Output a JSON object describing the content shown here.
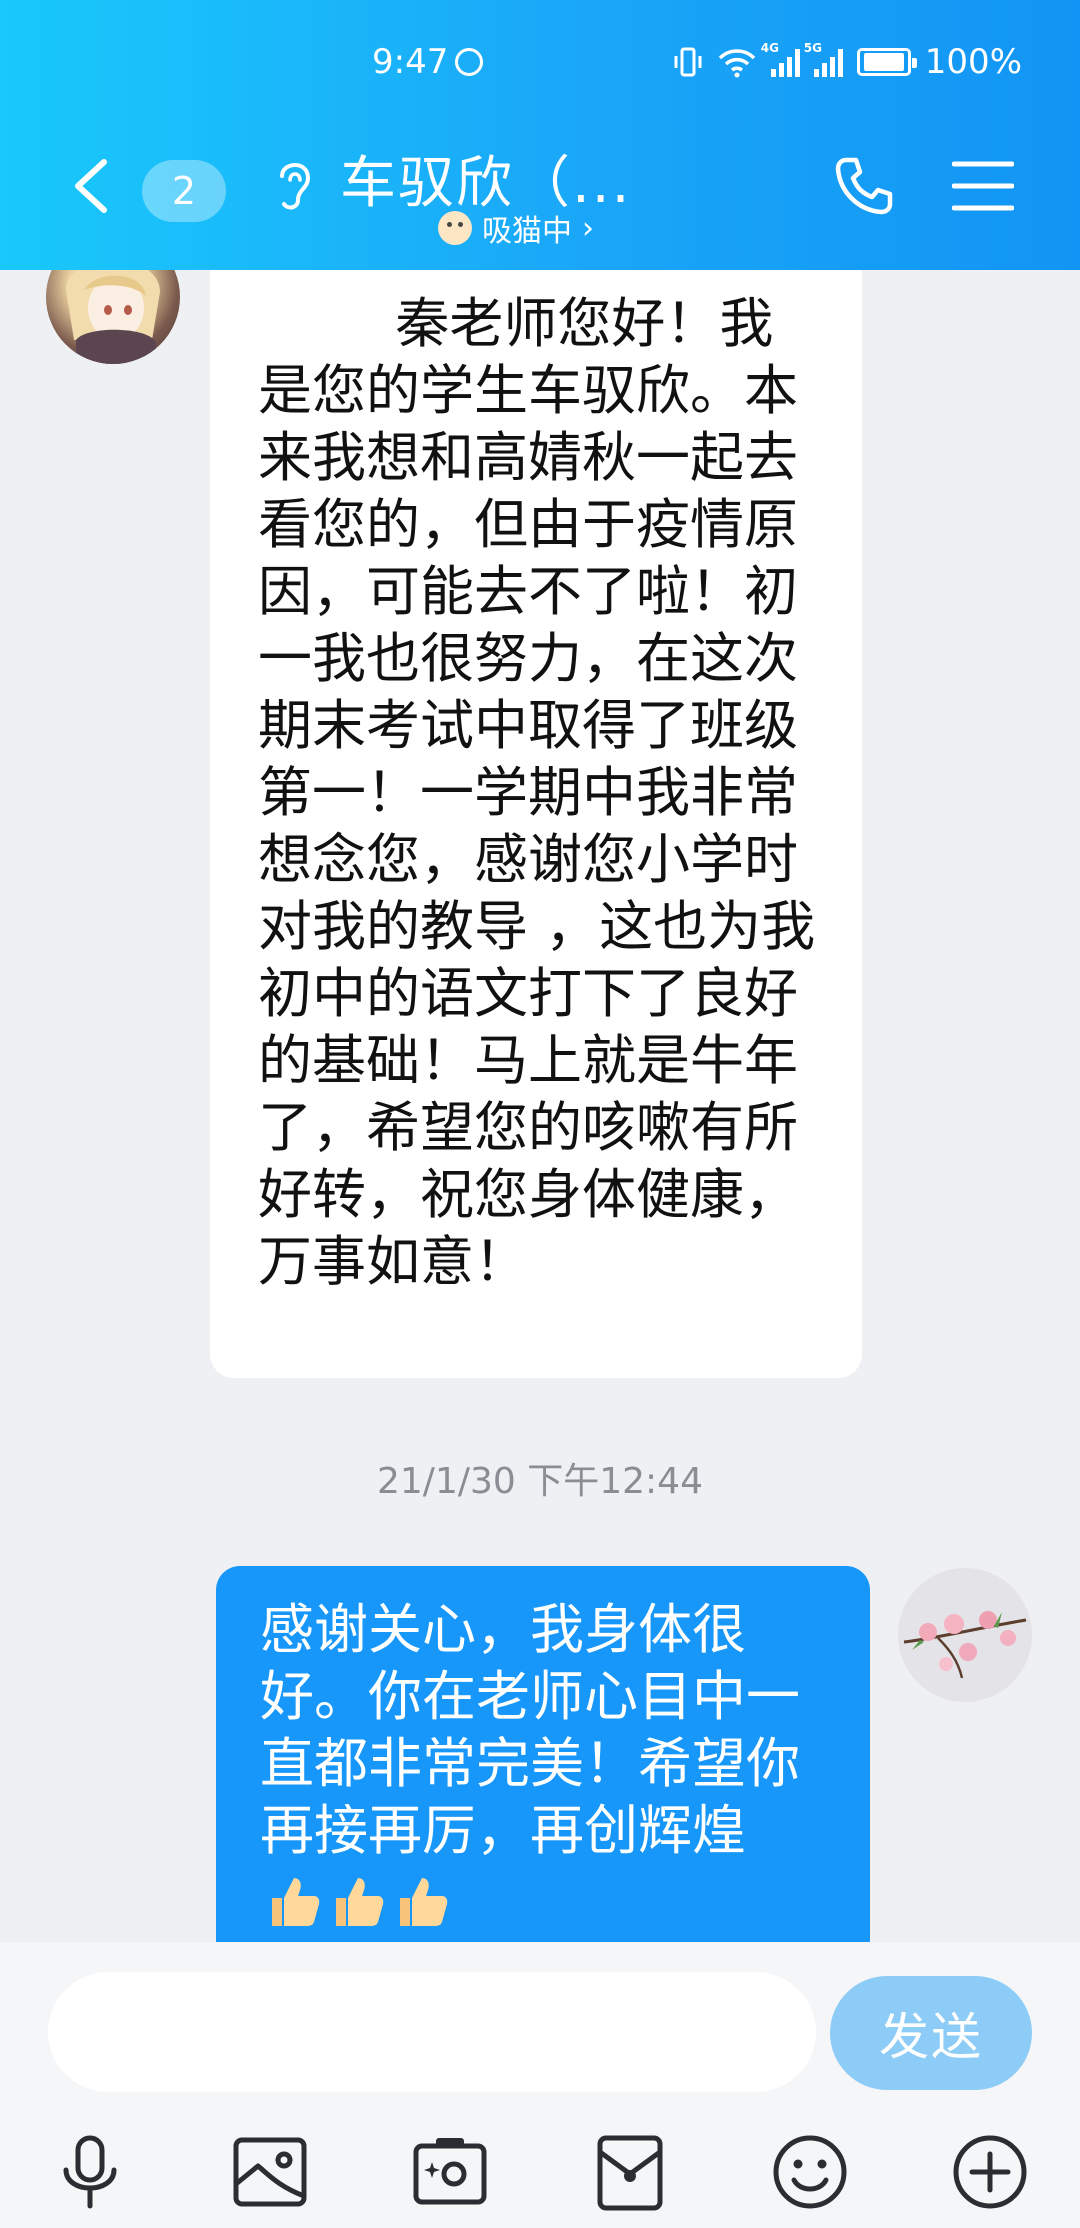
{
  "status_bar": {
    "time": "9:47",
    "network_1": "4G",
    "network_2": "5G",
    "battery": "100%"
  },
  "header": {
    "unread_count": "2",
    "contact_name": "车驭欣（...",
    "contact_status": "吸猫中",
    "status_chevron": "›"
  },
  "messages": [
    {
      "direction": "incoming",
      "text": "        秦老师您好！我是您的学生车驭欣。本来我想和高婧秋一起去看您的，但由于疫情原因，可能去不了啦！初一我也很努力，在这次期末考试中取得了班级第一！一学期中我非常想念您，感谢您小学时对我的教导 ，这也为我初中的语文打下了良好的基础！马上就是牛年了，希望您的咳嗽有所好转，祝您身体健康，万事如意！"
    },
    {
      "direction": "outgoing",
      "text": "感谢关心，我身体很好。你在老师心目中一直都非常完美！希望你再接再厉，再创辉煌",
      "emoji": "👍👍👍"
    }
  ],
  "timestamp": "21/1/30 下午12:44",
  "input": {
    "value": "",
    "send_label": "发送"
  },
  "toolbar": {
    "icons": [
      "microphone-icon",
      "image-icon",
      "camera-icon",
      "red-packet-icon",
      "emoji-icon",
      "plus-icon"
    ]
  },
  "colors": {
    "header_gradient_start": "#19c9fb",
    "header_gradient_end": "#1195f4",
    "outgoing_bubble": "#1797f9",
    "send_button": "#8dccf6"
  }
}
